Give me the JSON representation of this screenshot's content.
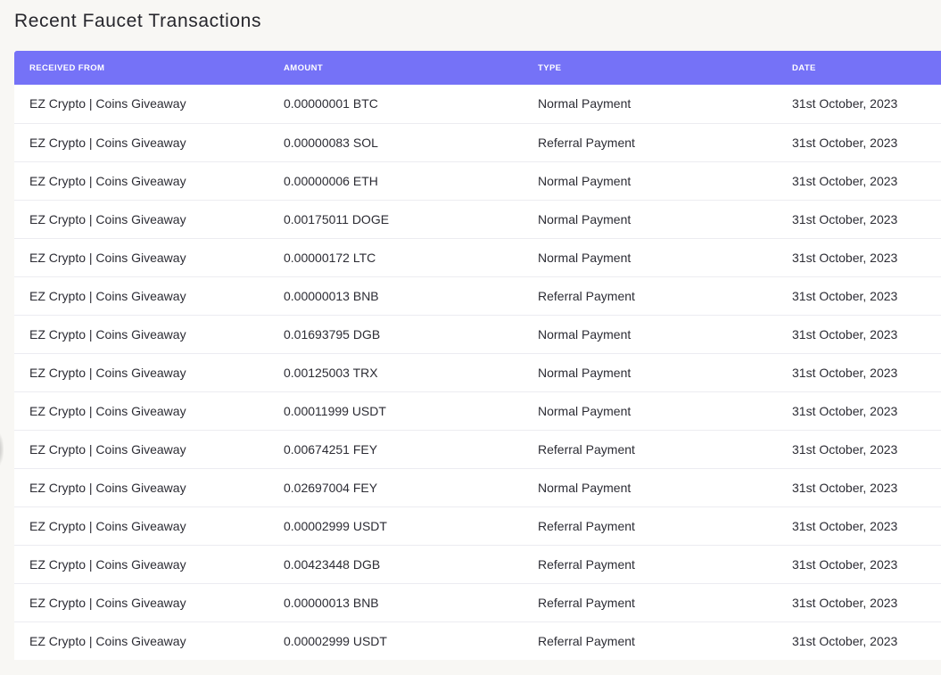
{
  "page": {
    "title": "Recent Faucet Transactions"
  },
  "table": {
    "columns": [
      "RECEIVED FROM",
      "AMOUNT",
      "TYPE",
      "DATE"
    ],
    "header_color": "#7572f7",
    "rows": [
      {
        "from": "EZ Crypto | Coins Giveaway",
        "amount": "0.00000001 BTC",
        "type": "Normal Payment",
        "date": "31st October, 2023"
      },
      {
        "from": "EZ Crypto | Coins Giveaway",
        "amount": "0.00000083 SOL",
        "type": "Referral Payment",
        "date": "31st October, 2023"
      },
      {
        "from": "EZ Crypto | Coins Giveaway",
        "amount": "0.00000006 ETH",
        "type": "Normal Payment",
        "date": "31st October, 2023"
      },
      {
        "from": "EZ Crypto | Coins Giveaway",
        "amount": "0.00175011 DOGE",
        "type": "Normal Payment",
        "date": "31st October, 2023"
      },
      {
        "from": "EZ Crypto | Coins Giveaway",
        "amount": "0.00000172 LTC",
        "type": "Normal Payment",
        "date": "31st October, 2023"
      },
      {
        "from": "EZ Crypto | Coins Giveaway",
        "amount": "0.00000013 BNB",
        "type": "Referral Payment",
        "date": "31st October, 2023"
      },
      {
        "from": "EZ Crypto | Coins Giveaway",
        "amount": "0.01693795 DGB",
        "type": "Normal Payment",
        "date": "31st October, 2023"
      },
      {
        "from": "EZ Crypto | Coins Giveaway",
        "amount": "0.00125003 TRX",
        "type": "Normal Payment",
        "date": "31st October, 2023"
      },
      {
        "from": "EZ Crypto | Coins Giveaway",
        "amount": "0.00011999 USDT",
        "type": "Normal Payment",
        "date": "31st October, 2023"
      },
      {
        "from": "EZ Crypto | Coins Giveaway",
        "amount": "0.00674251 FEY",
        "type": "Referral Payment",
        "date": "31st October, 2023"
      },
      {
        "from": "EZ Crypto | Coins Giveaway",
        "amount": "0.02697004 FEY",
        "type": "Normal Payment",
        "date": "31st October, 2023"
      },
      {
        "from": "EZ Crypto | Coins Giveaway",
        "amount": "0.00002999 USDT",
        "type": "Referral Payment",
        "date": "31st October, 2023"
      },
      {
        "from": "EZ Crypto | Coins Giveaway",
        "amount": "0.00423448 DGB",
        "type": "Referral Payment",
        "date": "31st October, 2023"
      },
      {
        "from": "EZ Crypto | Coins Giveaway",
        "amount": "0.00000013 BNB",
        "type": "Referral Payment",
        "date": "31st October, 2023"
      },
      {
        "from": "EZ Crypto | Coins Giveaway",
        "amount": "0.00002999 USDT",
        "type": "Referral Payment",
        "date": "31st October, 2023"
      }
    ]
  }
}
